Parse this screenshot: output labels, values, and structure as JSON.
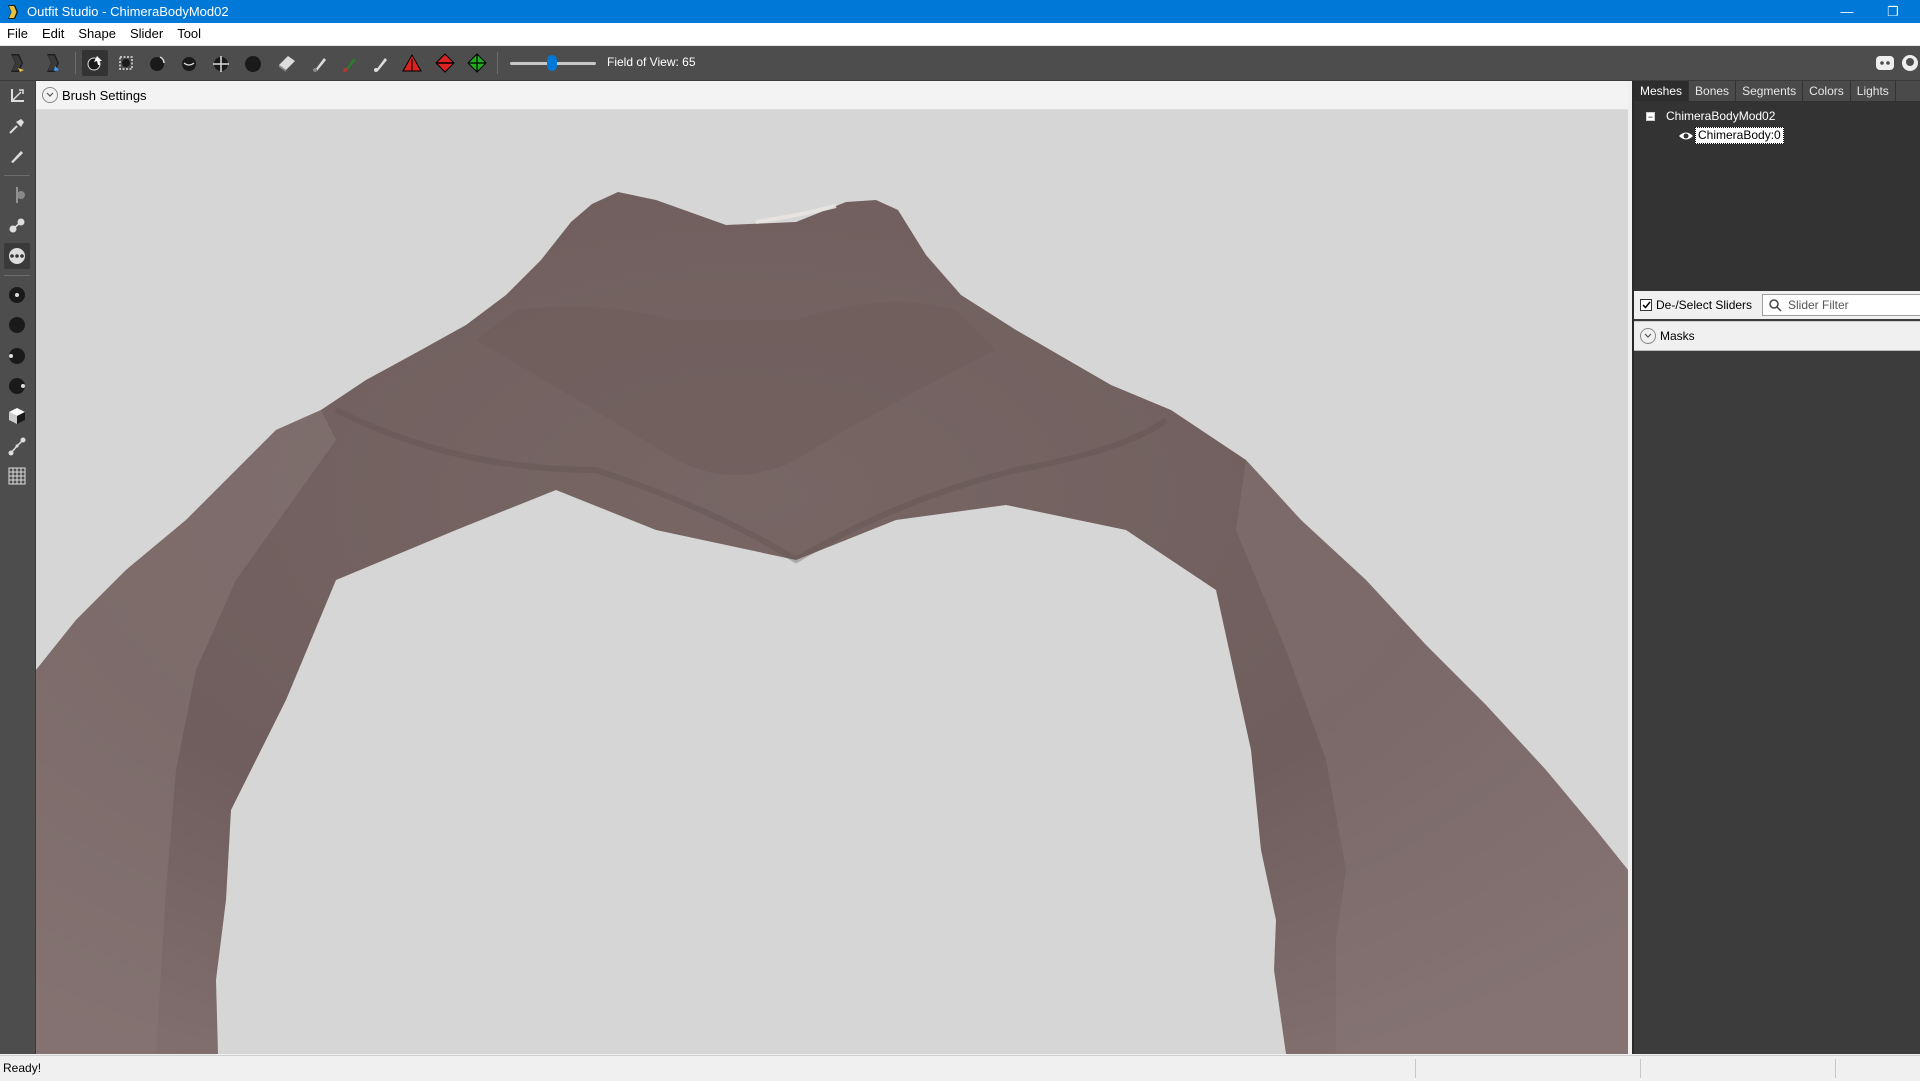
{
  "window": {
    "title": "Outfit Studio - ChimeraBodyMod02",
    "minimize_glyph": "—",
    "restore_glyph": "❐"
  },
  "menu": [
    "File",
    "Edit",
    "Shape",
    "Slider",
    "Tool"
  ],
  "toolbar": {
    "field_of_view_label": "Field of View: 65",
    "field_of_view_value": 65,
    "icons": [
      "logo-back-icon",
      "logo-forward-icon",
      "select-brush-icon",
      "mask-icon",
      "inflate-icon",
      "deflate-icon",
      "move-icon",
      "smooth-icon",
      "undiff-icon",
      "weight-brush-icon",
      "color-brush-icon",
      "alpha-brush-icon",
      "vertex-red-icon",
      "vertex-red-diamond-icon",
      "vertex-green-icon"
    ],
    "right_icons": [
      "discord-icon",
      "github-icon"
    ]
  },
  "left_tools": [
    "select-tool-icon",
    "transform-tool-icon",
    "pivot-tool-icon",
    "vertex-select-icon",
    "collapse-vertex-icon",
    "flip-edge-icon",
    "split-edge-icon",
    "brush-size-small-icon",
    "brush-size-medium-icon",
    "brush-size-large-icon",
    "brush-size-xl-icon",
    "cube-view-icon",
    "bone-tool-icon",
    "grid-icon"
  ],
  "brush_settings": {
    "label": "Brush Settings"
  },
  "right_panel": {
    "tabs": [
      "Meshes",
      "Bones",
      "Segments",
      "Colors",
      "Lights"
    ],
    "active_tab": "Meshes",
    "tree": {
      "root": "ChimeraBodyMod02",
      "child": "ChimeraBody:0",
      "expander_glyph": "−"
    },
    "sliders_toggle_label": "De-/Select Sliders",
    "sliders_checked": true,
    "slider_filter_placeholder": "Slider Filter",
    "masks_label": "Masks"
  },
  "status": {
    "text": "Ready!"
  },
  "colors": {
    "titlebar": "#0078d7",
    "toolbar": "#4d4d4d",
    "viewport_bg": "#d6d6d6",
    "skin": "#7b6a69"
  }
}
